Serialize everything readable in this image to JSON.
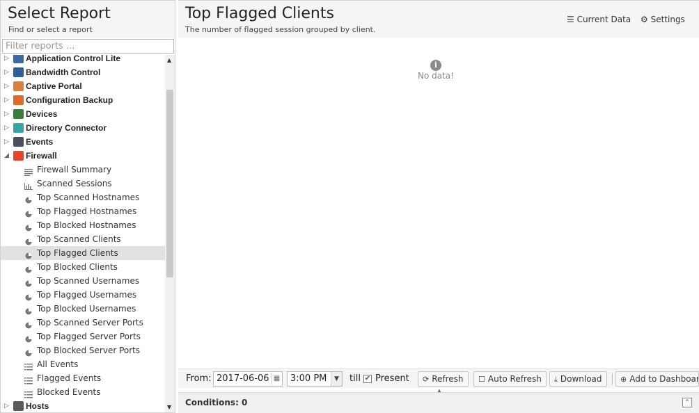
{
  "left": {
    "title": "Select Report",
    "subtitle": "Find or select a report",
    "filter_placeholder": "Filter reports ...",
    "tree": [
      {
        "kind": "cat",
        "label": "Application Control Lite",
        "expanded": false,
        "icon_color": "#3a6aa8"
      },
      {
        "kind": "cat",
        "label": "Bandwidth Control",
        "expanded": false,
        "icon_color": "#2d5e9c"
      },
      {
        "kind": "cat",
        "label": "Captive Portal",
        "expanded": false,
        "icon_color": "#d9823c"
      },
      {
        "kind": "cat",
        "label": "Configuration Backup",
        "expanded": false,
        "icon_color": "#e06a2a"
      },
      {
        "kind": "cat",
        "label": "Devices",
        "expanded": false,
        "icon_color": "#3b7d3b"
      },
      {
        "kind": "cat",
        "label": "Directory Connector",
        "expanded": false,
        "icon_color": "#3aa5a0"
      },
      {
        "kind": "cat",
        "label": "Events",
        "expanded": false,
        "icon_color": "#4a4f5a"
      },
      {
        "kind": "cat",
        "label": "Firewall",
        "expanded": true,
        "icon_color": "#e5462a"
      },
      {
        "kind": "rep",
        "label": "Firewall Summary",
        "icon": "text-lines-icon"
      },
      {
        "kind": "rep",
        "label": "Scanned Sessions",
        "icon": "bar-chart-icon"
      },
      {
        "kind": "rep",
        "label": "Top Scanned Hostnames",
        "icon": "pie-chart-icon"
      },
      {
        "kind": "rep",
        "label": "Top Flagged Hostnames",
        "icon": "pie-chart-icon"
      },
      {
        "kind": "rep",
        "label": "Top Blocked Hostnames",
        "icon": "pie-chart-icon"
      },
      {
        "kind": "rep",
        "label": "Top Scanned Clients",
        "icon": "pie-chart-icon"
      },
      {
        "kind": "rep",
        "label": "Top Flagged Clients",
        "icon": "pie-chart-icon",
        "selected": true
      },
      {
        "kind": "rep",
        "label": "Top Blocked Clients",
        "icon": "pie-chart-icon"
      },
      {
        "kind": "rep",
        "label": "Top Scanned Usernames",
        "icon": "pie-chart-icon"
      },
      {
        "kind": "rep",
        "label": "Top Flagged Usernames",
        "icon": "pie-chart-icon"
      },
      {
        "kind": "rep",
        "label": "Top Blocked Usernames",
        "icon": "pie-chart-icon"
      },
      {
        "kind": "rep",
        "label": "Top Scanned Server Ports",
        "icon": "pie-chart-icon"
      },
      {
        "kind": "rep",
        "label": "Top Flagged Server Ports",
        "icon": "pie-chart-icon"
      },
      {
        "kind": "rep",
        "label": "Top Blocked Server Ports",
        "icon": "pie-chart-icon"
      },
      {
        "kind": "rep",
        "label": "All Events",
        "icon": "list-icon"
      },
      {
        "kind": "rep",
        "label": "Flagged Events",
        "icon": "list-icon"
      },
      {
        "kind": "rep",
        "label": "Blocked Events",
        "icon": "list-icon"
      },
      {
        "kind": "cat",
        "label": "Hosts",
        "expanded": false,
        "icon_color": "#5a5a5a"
      }
    ]
  },
  "right": {
    "title": "Top Flagged Clients",
    "subtitle": "The number of flagged session grouped by client.",
    "current_data_label": "Current Data",
    "settings_label": "Settings",
    "no_data": "No data!"
  },
  "toolbar": {
    "from_label": "From:",
    "date_value": "2017-06-06",
    "time_value": "3:00 PM",
    "till_label": "till",
    "present_checked": true,
    "present_label": "Present",
    "refresh_label": "Refresh",
    "auto_refresh_label": "Auto Refresh",
    "download_label": "Download",
    "add_dashboard_label": "Add to Dashboard"
  },
  "conditions": {
    "label": "Conditions: 0"
  }
}
